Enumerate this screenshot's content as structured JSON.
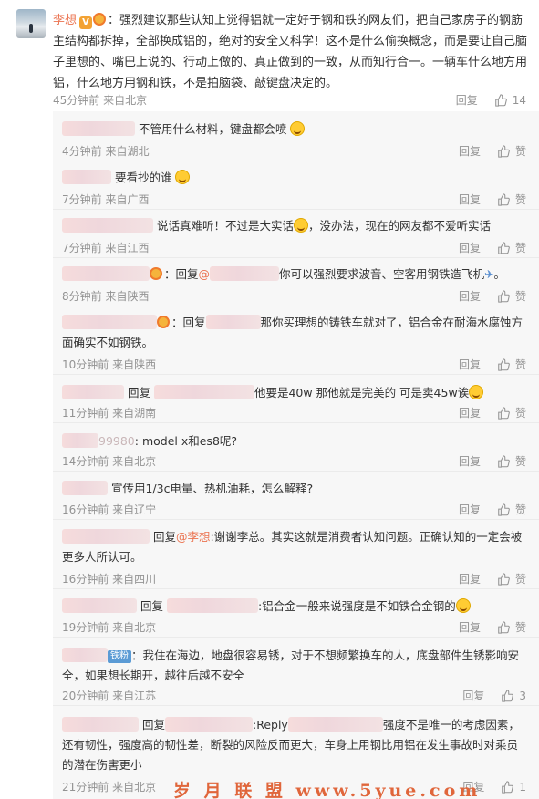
{
  "main_comment": {
    "username": "李想",
    "text": "：强烈建议那些认知上觉得铝就一定好于钢和铁的网友们，把自己家房子的钢筋主结构都拆掉，全部换成铝的，绝对的安全又科学！这不是什么偷换概念，而是要让自己脑子里想的、嘴巴上说的、行动上做的、真正做到的一致，从而知行合一。一辆车什么地方用铝，什么地方用钢和铁，不是拍脑袋、敲键盘决定的。",
    "time": "45分钟前",
    "location": "来自北京",
    "reply_label": "回复",
    "likes": "14"
  },
  "replies": [
    {
      "text": "不管用什么材料，键盘都会喷",
      "time": "4分钟前",
      "location": "来自湖北",
      "reply_label": "回复",
      "likes": "赞"
    },
    {
      "text": "要看抄的谁",
      "time": "7分钟前",
      "location": "来自广西",
      "reply_label": "回复",
      "likes": "赞"
    },
    {
      "text_a": "说话真难听！不过是大实话",
      "text_b": "，没办法，现在的网友都不爱听实话",
      "time": "7分钟前",
      "location": "来自江西",
      "reply_label": "回复",
      "likes": "赞"
    },
    {
      "prefix": "：回复",
      "link": "@",
      "text": "你可以强烈要求波音、空客用钢铁造飞机",
      "time": "8分钟前",
      "location": "来自陕西",
      "reply_label": "回复",
      "likes": "赞"
    },
    {
      "prefix": "：回复",
      "text": "那你买理想的铸铁车就对了，铝合金在耐海水腐蚀方面确实不如钢铁。",
      "time": "10分钟前",
      "location": "来自陕西",
      "reply_label": "回复",
      "likes": "赞"
    },
    {
      "prefix": "回复",
      "text": "他要是40w 那他就是完美的 可是卖45w诶",
      "time": "11分钟前",
      "location": "来自湖南",
      "reply_label": "回复",
      "likes": "赞"
    },
    {
      "name_tail": "99980",
      "text": ": model x和es8呢?",
      "time": "14分钟前",
      "location": "来自北京",
      "reply_label": "回复",
      "likes": "赞"
    },
    {
      "text": "宣传用1/3c电量、热机油耗，怎么解释?",
      "time": "16分钟前",
      "location": "来自辽宁",
      "reply_label": "回复",
      "likes": "赞"
    },
    {
      "prefix": "回复",
      "link": "@李想",
      "text": ":谢谢李总。其实这就是消费者认知问题。正确认知的一定会被更多人所认可。",
      "time": "16分钟前",
      "location": "来自四川",
      "reply_label": "回复",
      "likes": "赞"
    },
    {
      "prefix": "回复",
      "text": ":铝合金一般来说强度是不如铁合金钢的",
      "time": "19分钟前",
      "location": "来自北京",
      "reply_label": "回复",
      "likes": "赞"
    },
    {
      "badge": "铁粉",
      "text": "我住在海边，地盘很容易锈，对于不想频繁换车的人，底盘部件生锈影响安全，如果想长期开，越往后越不安全",
      "time": "20分钟前",
      "location": "来自江苏",
      "reply_label": "回复",
      "likes": "3"
    },
    {
      "prefix": "回复",
      "mid": ":Reply",
      "text": "强度不是唯一的考虑因素，还有韧性，强度高的韧性差，断裂的风险反而更大，车身上用钢比用铝在发生事故时对乘员的潜在伤害更小",
      "time": "21分钟前",
      "location": "来自北京",
      "reply_label": "回复",
      "likes": "1"
    }
  ],
  "watermark": "岁 月 联 盟  www.5yue.com",
  "colors": {
    "accent": "#eb7350",
    "meta": "#939393",
    "sub_bg": "#f7f7f7"
  }
}
